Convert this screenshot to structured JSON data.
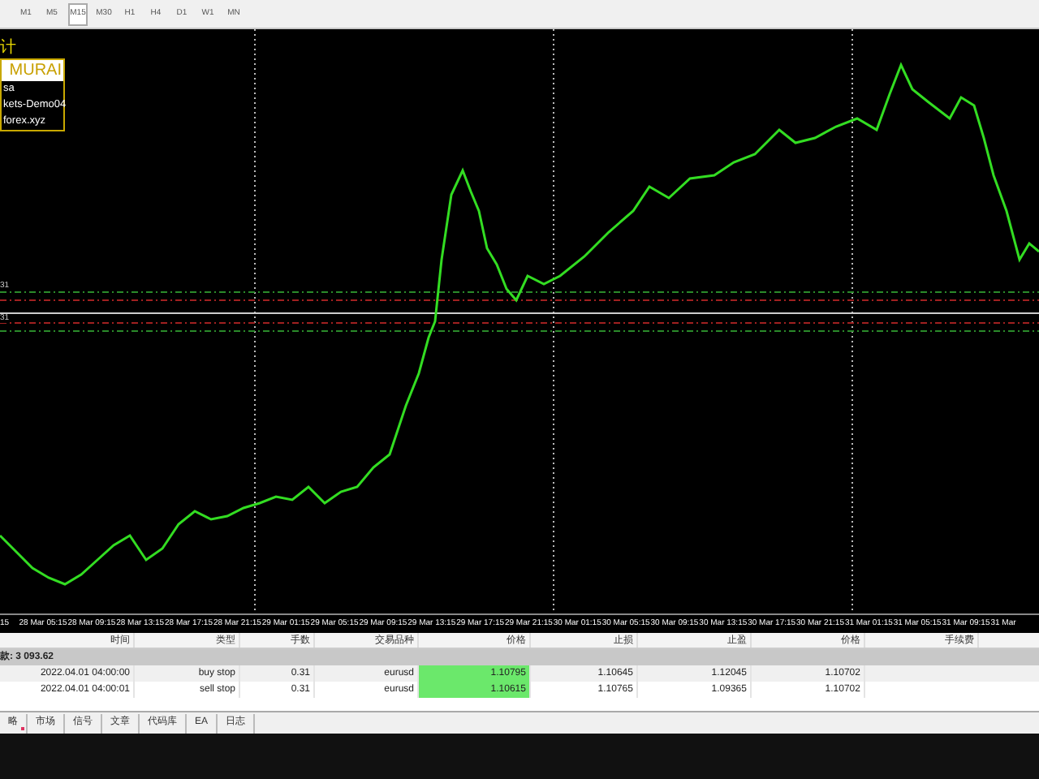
{
  "toolbar": {
    "timeframes": [
      {
        "label": "M1",
        "selected": false
      },
      {
        "label": "M5",
        "selected": false
      },
      {
        "label": "M15",
        "selected": true
      },
      {
        "label": "M30",
        "selected": false
      },
      {
        "label": "H1",
        "selected": false
      },
      {
        "label": "H4",
        "selected": false
      },
      {
        "label": "D1",
        "selected": false
      },
      {
        "label": "W1",
        "selected": false
      },
      {
        "label": "MN",
        "selected": false
      }
    ]
  },
  "chart": {
    "overlay_title": "计",
    "info_box": {
      "header": "MURAI",
      "lines": [
        "sa",
        "kets-Demo04",
        "forex.xyz"
      ]
    },
    "level_labels": [
      "31",
      "31"
    ],
    "time_axis": [
      "15",
      "28 Mar 05:15",
      "28 Mar 09:15",
      "28 Mar 13:15",
      "28 Mar 17:15",
      "28 Mar 21:15",
      "29 Mar 01:15",
      "29 Mar 05:15",
      "29 Mar 09:15",
      "29 Mar 13:15",
      "29 Mar 17:15",
      "29 Mar 21:15",
      "30 Mar 01:15",
      "30 Mar 05:15",
      "30 Mar 09:15",
      "30 Mar 13:15",
      "30 Mar 17:15",
      "30 Mar 21:15",
      "31 Mar 01:15",
      "31 Mar 05:15",
      "31 Mar 09:15",
      "31 Mar"
    ]
  },
  "table": {
    "columns": [
      "时间",
      "类型",
      "手数",
      "交易品种",
      "价格",
      "止损",
      "止盈",
      "价格",
      "手续费"
    ],
    "summary": "款: 3 093.62",
    "rows": [
      {
        "cells": [
          "2022.04.01 04:00:00",
          "buy stop",
          "0.31",
          "eurusd",
          "1.10795",
          "1.10645",
          "1.12045",
          "1.10702"
        ]
      },
      {
        "cells": [
          "2022.04.01 04:00:01",
          "sell stop",
          "0.31",
          "eurusd",
          "1.10615",
          "1.10765",
          "1.09365",
          "1.10702"
        ]
      }
    ]
  },
  "bottom_tabs": [
    {
      "label": "略",
      "selected": false,
      "badge": true
    },
    {
      "label": "市场",
      "selected": false,
      "badge": false
    },
    {
      "label": "信号",
      "selected": false,
      "badge": false
    },
    {
      "label": "文章",
      "selected": false,
      "badge": false
    },
    {
      "label": "代码库",
      "selected": false,
      "badge": false
    },
    {
      "label": "EA",
      "selected": false,
      "badge": false
    },
    {
      "label": "日志",
      "selected": false,
      "badge": false
    }
  ]
}
